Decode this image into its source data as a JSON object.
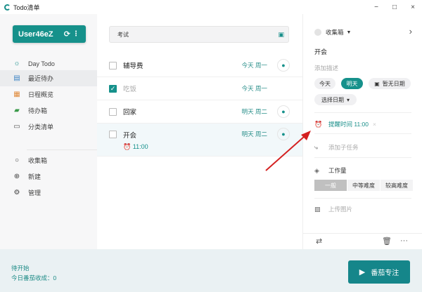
{
  "window": {
    "title": "Todo清单",
    "controls": [
      "−",
      "□",
      "×"
    ]
  },
  "sidebar": {
    "user": "User46eZ",
    "items": [
      {
        "label": "Day Todo",
        "icon": "sun-icon"
      },
      {
        "label": "最近待办",
        "icon": "calendar-icon"
      },
      {
        "label": "日程概览",
        "icon": "schedule-icon"
      },
      {
        "label": "待办箱",
        "icon": "inbox-icon"
      },
      {
        "label": "分类清单",
        "icon": "category-icon"
      },
      {
        "label": "收集箱",
        "icon": "circle-icon"
      },
      {
        "label": "新建",
        "icon": "plus-icon"
      },
      {
        "label": "管理",
        "icon": "gear-icon"
      }
    ]
  },
  "main": {
    "search_value": "考试",
    "tasks": [
      {
        "name": "辅导费",
        "date": "今天 周一",
        "done": false
      },
      {
        "name": "吃饭",
        "date": "今天 周一",
        "done": true
      },
      {
        "name": "回家",
        "date": "明天 周二",
        "done": false
      },
      {
        "name": "开会",
        "date": "明天 周二",
        "done": false,
        "reminder": "11:00"
      }
    ]
  },
  "detail": {
    "list": "收集箱",
    "title": "开会",
    "desc_placeholder": "添加描述",
    "dates": [
      "今天",
      "明天",
      "暂无日期",
      "选择日期"
    ],
    "reminder": "提醒时间 11:00",
    "subtask": "添加子任务",
    "workload_label": "工作量",
    "workload": [
      "一般",
      "中等难度",
      "较高难度"
    ],
    "upload": "上传图片"
  },
  "footer": {
    "status": "待开始",
    "today": "今日番茄收成：0",
    "focus_button": "番茄专注"
  },
  "colors": {
    "accent": "#16918b",
    "arrow": "#d42020"
  }
}
